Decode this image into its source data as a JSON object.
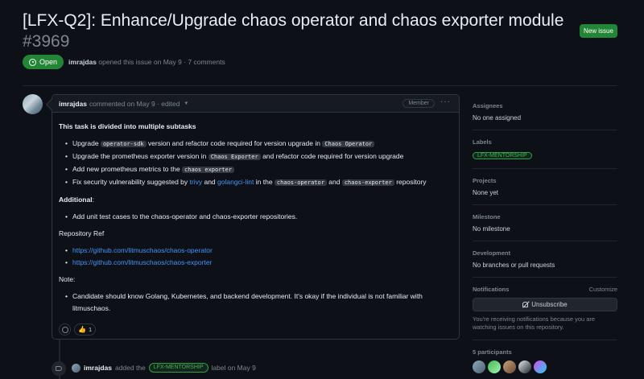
{
  "issue": {
    "title": "[LFX-Q2]: Enhance/Upgrade chaos operator and chaos exporter module",
    "number": "#3969",
    "new_issue_label": "New issue",
    "state": "Open",
    "author": "imrajdas",
    "opened_text": "opened this issue on May 9 · 7 comments"
  },
  "comment": {
    "author": "imrajdas",
    "meta": "commented on May 9 · edited",
    "role_badge": "Member",
    "more_label": "···",
    "heading": "This task is divided into multiple subtasks",
    "subtasks": [
      {
        "parts": [
          "Upgrade ",
          {
            "code": "operator-sdk"
          },
          " version and refactor code required for version upgrade in ",
          {
            "code": "Chaos Operator"
          }
        ]
      },
      {
        "parts": [
          "Upgrade the prometheus exporter version in ",
          {
            "code": "Chaos Exporter"
          },
          " and refactor code required for version upgrade"
        ]
      },
      {
        "parts": [
          "Add new prometheus metrics to the ",
          {
            "code": "chaos exporter"
          }
        ]
      },
      {
        "parts": [
          "Fix security vulnerability suggested by ",
          {
            "link": "trivy"
          },
          " and ",
          {
            "link": "golangci-lint"
          },
          " in the ",
          {
            "code": "chaos-operator"
          },
          " and ",
          {
            "code": "chaos-exporter"
          },
          " repository"
        ]
      }
    ],
    "additional_label": "Additional",
    "additional_items": [
      "Add unit test cases to the chaos-operator and chaos-exporter repositories."
    ],
    "repo_ref_label": "Repository Ref",
    "repo_links": [
      "https://github.com/litmuschaos/chaos-operator",
      "https://github.com/litmuschaos/chaos-exporter"
    ],
    "note_label": "Note:",
    "note_items": [
      "Candidate should know Golang, Kubernetes, and backend development. It's okay if the individual is not familiar with litmuschaos."
    ],
    "reaction_icon": "thumbs-up",
    "reaction_count": "1"
  },
  "timeline": {
    "actor": "imrajdas",
    "action": "added the",
    "label": "LFX-MENTORSHIP",
    "suffix": "label on May 9"
  },
  "sidebar": {
    "assignees_h": "Assignees",
    "assignees_v": "No one assigned",
    "labels_h": "Labels",
    "label": "LFX-MENTORSHIP",
    "projects_h": "Projects",
    "projects_v": "None yet",
    "milestone_h": "Milestone",
    "milestone_v": "No milestone",
    "development_h": "Development",
    "development_v": "No branches or pull requests",
    "notifications_h": "Notifications",
    "customize": "Customize",
    "unsubscribe": "Unsubscribe",
    "notif_note": "You're receiving notifications because you are watching issues on this repository.",
    "participants_h": "5 participants"
  },
  "colors": {
    "background": "#0d1117",
    "green": "#238636",
    "label_green": "#3fb950",
    "link": "#4493f8"
  }
}
